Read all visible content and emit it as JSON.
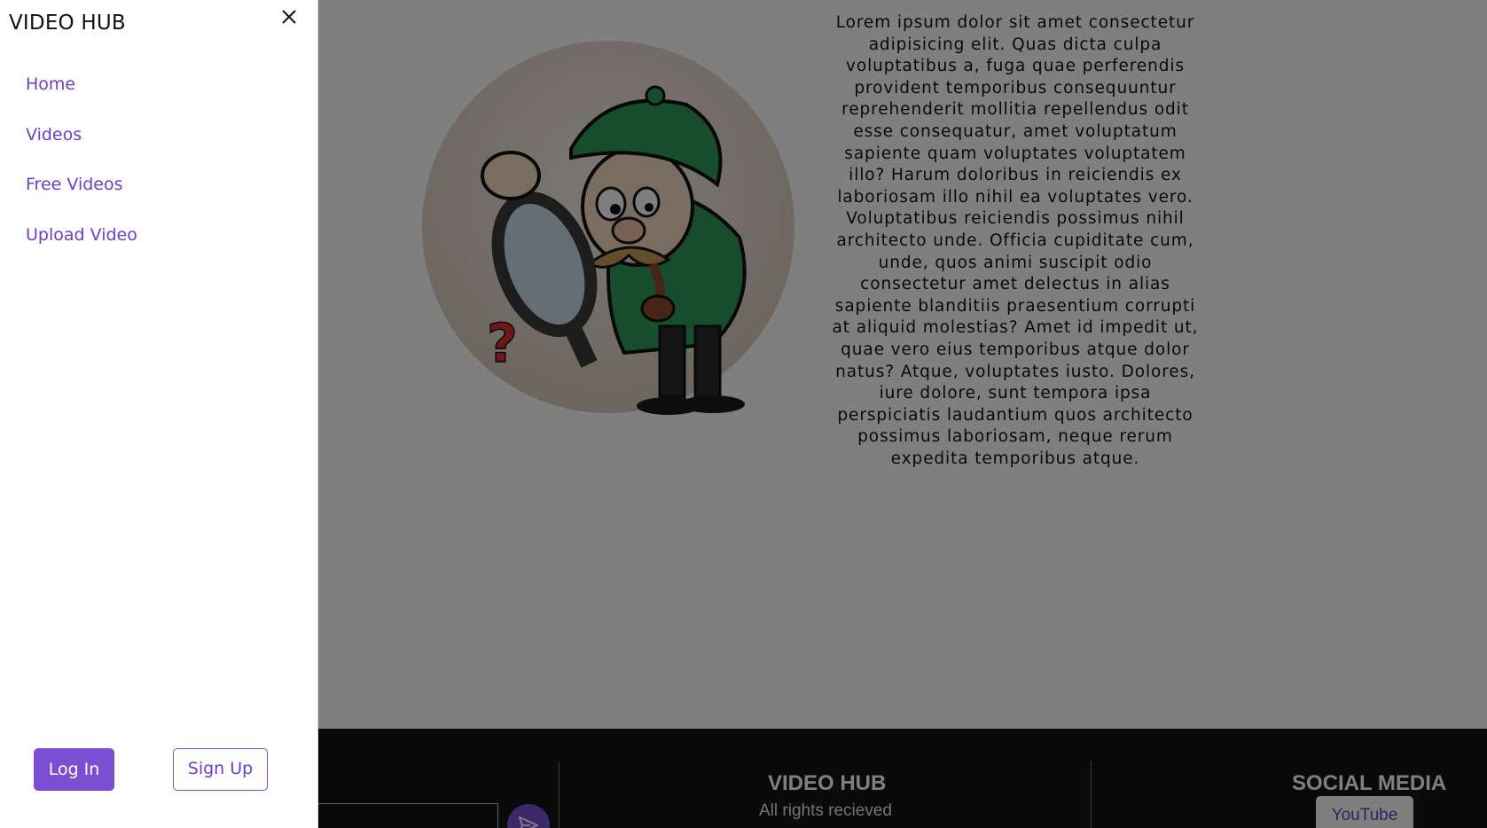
{
  "sidebar": {
    "brand": "VIDEO HUB",
    "nav": [
      {
        "label": "Home"
      },
      {
        "label": "Videos"
      },
      {
        "label": "Free Videos"
      },
      {
        "label": "Upload Video"
      }
    ],
    "login_label": "Log In",
    "signup_label": "Sign Up"
  },
  "hero": {
    "text": "Lorem ipsum dolor sit amet consectetur adipisicing elit. Quas dicta culpa voluptatibus a, fuga quae perferendis provident temporibus consequuntur reprehenderit mollitia repellendus odit esse consequatur, amet voluptatum sapiente quam voluptates voluptatem illo? Harum doloribus in reiciendis ex laboriosam illo nihil ea voluptates vero. Voluptatibus reiciendis possimus nihil architecto unde. Officia cupiditate cum, unde, quos animi suscipit odio consectetur amet delectus in alias sapiente blanditiis praesentium corrupti at aliquid molestias? Amet id impedit ut, quae vero eius temporibus atque dolor natus? Atque, voluptates iusto. Dolores, iure dolore, sunt tempora ipsa perspiciatis laudantium quos architecto possimus laboriosam, neque rerum expedita temporibus atque."
  },
  "footer": {
    "brand_title": "VIDEO HUB",
    "brand_sub": "All rights recieved",
    "social_title": "SOCIAL MEDIA",
    "youtube_label": "YouTube"
  },
  "colors": {
    "accent": "#7a4fd2",
    "overlay": "rgba(0,0,0,0.5)",
    "footer_bg": "#141414"
  },
  "icons": [
    "close-icon",
    "detective-illustration",
    "send-icon"
  ]
}
